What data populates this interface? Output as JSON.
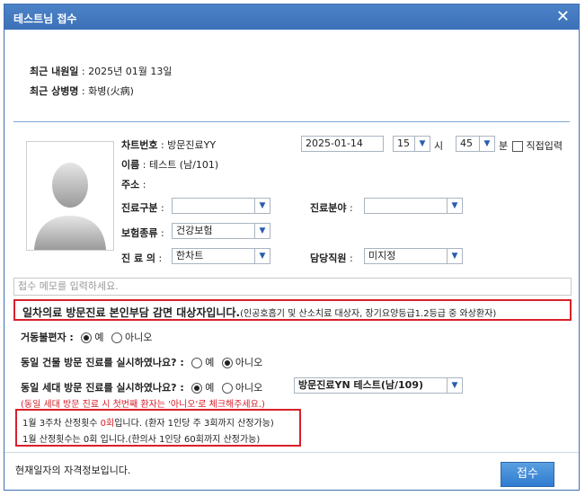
{
  "window": {
    "title": "테스트님 접수",
    "close_symbol": "✕"
  },
  "recent": {
    "visit_label": "최근 내원일",
    "visit_value": " : 2025년 01월 13일",
    "illness_label": "최근 상병명",
    "illness_value": " : 화병(火病)"
  },
  "patient": {
    "chart_label": "차트번호",
    "chart_value": " : 방문진료YY",
    "name_label": "이름",
    "name_value": " : 테스트 (남/101)",
    "address_label": "주소",
    "address_value": " :"
  },
  "datetime": {
    "date": "2025-01-14",
    "hour": "15",
    "hour_unit": "시",
    "minute": "45",
    "minute_unit": "분",
    "direct_input_label": "직접입력"
  },
  "form": {
    "visit_type_label": "진료구분",
    "visit_type_value": "",
    "department_label": "진료분야",
    "department_value": "",
    "insurance_label": "보험종류",
    "insurance_value": "건강보험",
    "doctor_label": "진 료 의",
    "doctor_value": "한차트",
    "staff_label": "담당직원",
    "staff_value": "미지정",
    "colon": " :"
  },
  "memo": {
    "placeholder": "접수 메모를 입력하세요."
  },
  "notice": {
    "main": "일차의료 방문진료 본인부담 감면 대상자입니다.",
    "detail": "(인공호흡기 및 산소치료 대상자, 장기요양등급1.2등급 중 와상환자)"
  },
  "mobility": {
    "label": "거동불편자 :",
    "yes": "예",
    "no": "아니오"
  },
  "same_building": {
    "question": "동일 건물 방문 진료를 실시하였나요? :",
    "yes": "예",
    "no": "아니오"
  },
  "same_household": {
    "question": "동일 세대 방문 진료를 실시하였나요? :",
    "yes": "예",
    "no": "아니오",
    "patient_select": "방문진료YN 테스트(남/109)",
    "warning": "(동일 세대 방문 진료 시 첫번째 환자는 '아니오'로 체크해주세요.)"
  },
  "count": {
    "line1_prefix": "1월 3주차 산정횟수 ",
    "line1_count": "0회",
    "line1_suffix": "입니다. (환자 1인당 주 3회까지 산정가능)",
    "line2": "1월 산정횟수는 0회 입니다.(한의사 1인당 60회까지 산정가능)"
  },
  "footer": {
    "qualification": "현재일자의 자격정보입니다.",
    "submit": "접수"
  }
}
